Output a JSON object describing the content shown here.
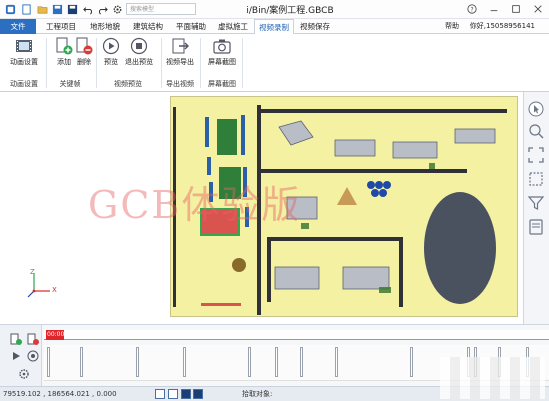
{
  "titlebar": {
    "search_placeholder": "搜索模型",
    "title": "i/Bin/案例工程.GBCB"
  },
  "tabs": [
    {
      "label": "文件"
    },
    {
      "label": "工程项目"
    },
    {
      "label": "地形地貌"
    },
    {
      "label": "建筑结构"
    },
    {
      "label": "平面辅助"
    },
    {
      "label": "虚拟施工"
    },
    {
      "label": "视频录制"
    },
    {
      "label": "视频保存"
    }
  ],
  "header_right": {
    "help": "帮助",
    "user": "你好,15058956141"
  },
  "ribbon": {
    "buttons": [
      {
        "label": "动画设置"
      },
      {
        "label": "添加"
      },
      {
        "label": "删除"
      },
      {
        "label": "预览"
      },
      {
        "label": "退出预览"
      },
      {
        "label": "视频导出"
      },
      {
        "label": "屏幕截图"
      }
    ],
    "groups": [
      {
        "label": "动画设置"
      },
      {
        "label": "关键帧"
      },
      {
        "label": "视频预览"
      },
      {
        "label": "导出视频"
      },
      {
        "label": "屏幕截图"
      }
    ]
  },
  "viewport": {
    "watermark": "GCB体验版",
    "axis_x": "X",
    "axis_z": "Z"
  },
  "timeline": {
    "marker": "00:00"
  },
  "statusbar": {
    "coords": "79519.102 , 186564.021 , 0.000",
    "pick": "拾取对象:"
  },
  "colors": {
    "accent": "#2c6fc0",
    "map_ground": "#f4f1a3",
    "marker": "#e0262d"
  }
}
